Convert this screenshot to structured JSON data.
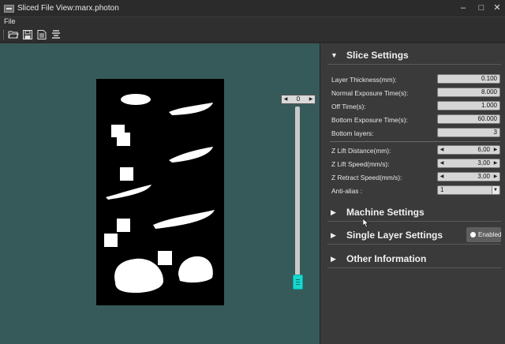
{
  "window": {
    "title": "Sliced File View:marx.photon",
    "minimize": "–",
    "maximize": "□",
    "close": "✕"
  },
  "menu": {
    "file": "File"
  },
  "toolbar": {
    "buttons": [
      "open-folder-icon",
      "save-icon",
      "export-file-icon",
      "align-layers-icon"
    ]
  },
  "viewer": {
    "layer_value": "0",
    "layer_fraction": 0.0,
    "colors": {
      "background": "#365a59",
      "canvas": "#000000",
      "slider_thumb": "#16d8cf"
    }
  },
  "slice_settings": {
    "title": "Slice Settings",
    "fields": [
      {
        "label": "Layer Thickness(mm):",
        "value": "0.100"
      },
      {
        "label": "Normal Exposure Time(s):",
        "value": "8.000"
      },
      {
        "label": "Off Time(s):",
        "value": "1.000"
      },
      {
        "label": "Bottom Exposure Time(s):",
        "value": "60.000"
      },
      {
        "label": "Bottom layers:",
        "value": "3"
      }
    ],
    "lift_fields": [
      {
        "label": "Z Lift Distance(mm):",
        "value": "6,00"
      },
      {
        "label": "Z Lift Speed(mm/s):",
        "value": "3,00"
      },
      {
        "label": "Z Retract Speed(mm/s):",
        "value": "3,00"
      }
    ],
    "antialias": {
      "label": "Anti-alias :",
      "value": "1"
    }
  },
  "sections": {
    "machine": "Machine Settings",
    "single_layer": "Single Layer Settings",
    "single_layer_toggle": "Enabled",
    "other": "Other Information"
  }
}
